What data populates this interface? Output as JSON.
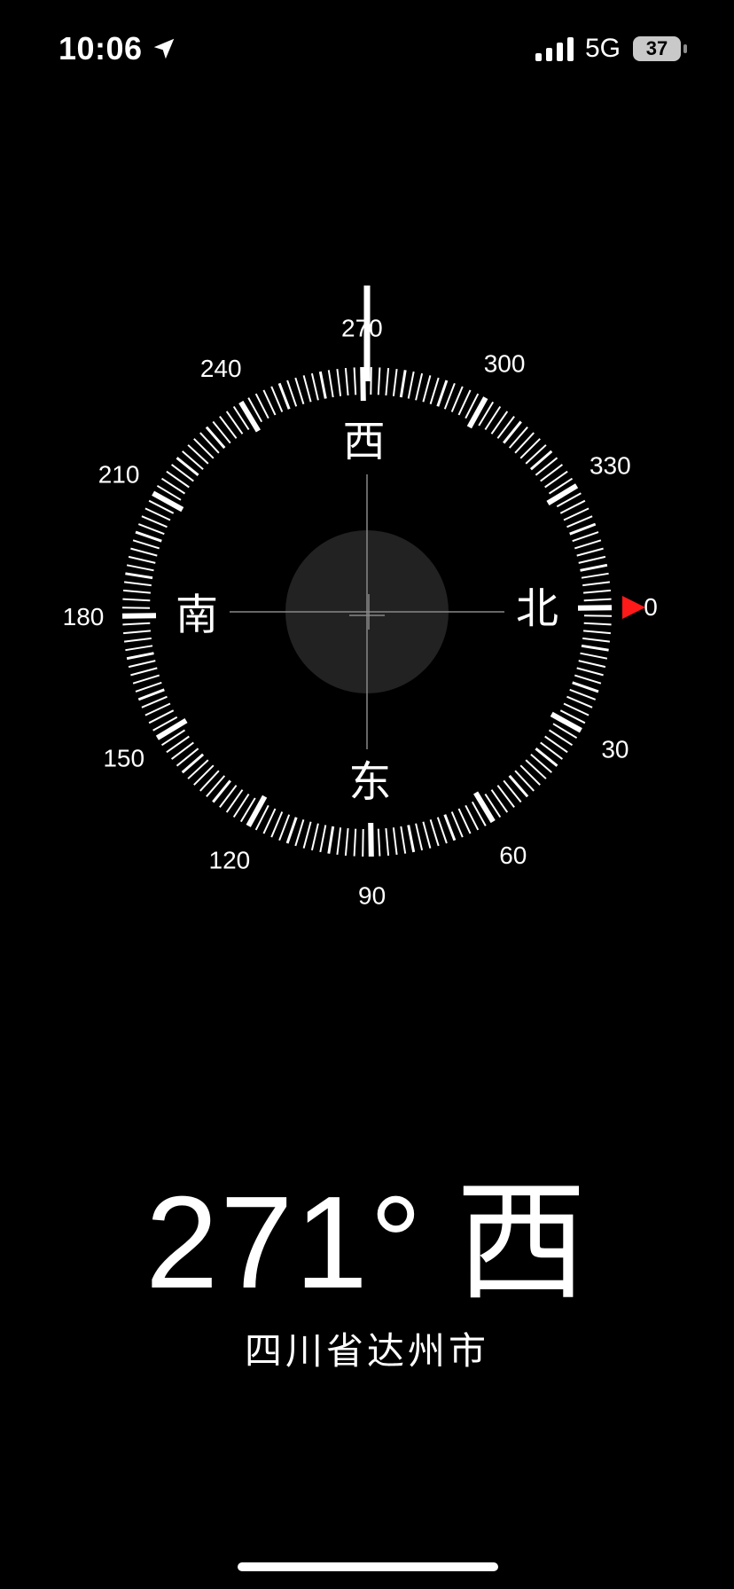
{
  "status_bar": {
    "time": "10:06",
    "network": "5G",
    "battery": "37",
    "icons": [
      "location-arrow-icon",
      "signal-icon",
      "battery-icon"
    ]
  },
  "compass": {
    "heading_degrees": 271,
    "degree_labels": [
      "0",
      "30",
      "60",
      "90",
      "120",
      "150",
      "180",
      "210",
      "240",
      "270",
      "300",
      "330"
    ],
    "cardinals": {
      "north": "北",
      "east": "东",
      "south": "南",
      "west": "西"
    },
    "target_marker_color": "#ff1a1a",
    "center_disc_color": "#222222",
    "tick_color": "#ffffff"
  },
  "reading": {
    "degrees": "271°",
    "direction": "西"
  },
  "location": "四川省达州市"
}
